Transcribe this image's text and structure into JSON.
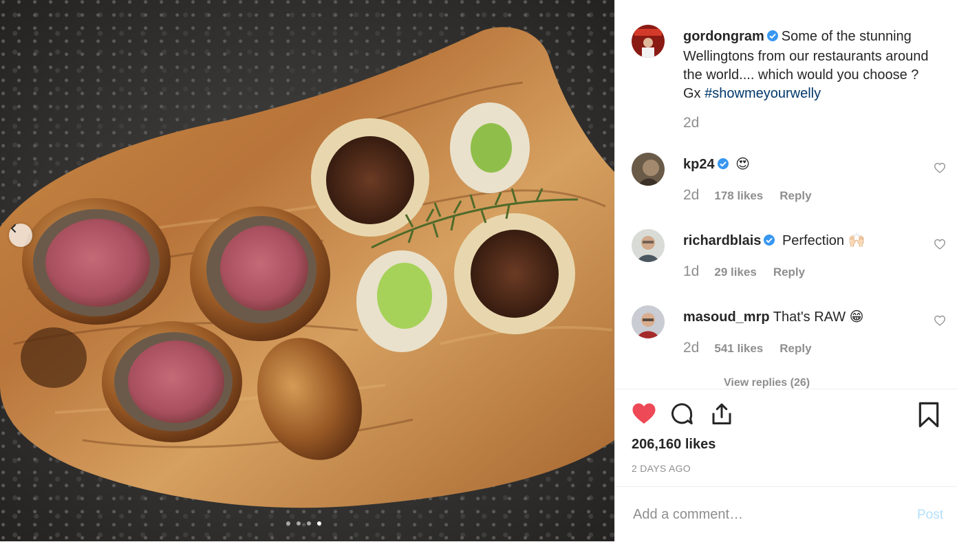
{
  "caption": {
    "username": "gordongram",
    "text": "Some of the stunning Wellingtons from our restaurants around the world.... which would you choose ? Gx",
    "hashtag": "#showmeyourwelly",
    "age": "2d"
  },
  "comments": [
    {
      "username": "kp24",
      "verified": true,
      "text": "😍",
      "age": "2d",
      "likes": "178 likes",
      "reply": "Reply"
    },
    {
      "username": "richardblais",
      "verified": true,
      "text": "Perfection 🙌🏻",
      "age": "1d",
      "likes": "29 likes",
      "reply": "Reply"
    },
    {
      "username": "masoud_mrp",
      "verified": false,
      "text": "That's RAW 😁",
      "age": "2d",
      "likes": "541 likes",
      "reply": "Reply"
    }
  ],
  "view_replies": "View replies (26)",
  "post_stats": {
    "likes": "206,160 likes",
    "date": "2 DAYS AGO"
  },
  "comment_box": {
    "placeholder": "Add a comment…",
    "post_label": "Post"
  },
  "carousel": {
    "count": 4,
    "active_index": 3
  },
  "colors": {
    "like_red": "#ed4956",
    "link_blue": "#00376b",
    "verified_blue": "#3897f0",
    "muted": "#8e8e8e"
  },
  "icons": [
    "chevron-left-icon",
    "verified-badge-icon",
    "heart-icon",
    "comment-icon",
    "share-icon",
    "bookmark-icon"
  ]
}
